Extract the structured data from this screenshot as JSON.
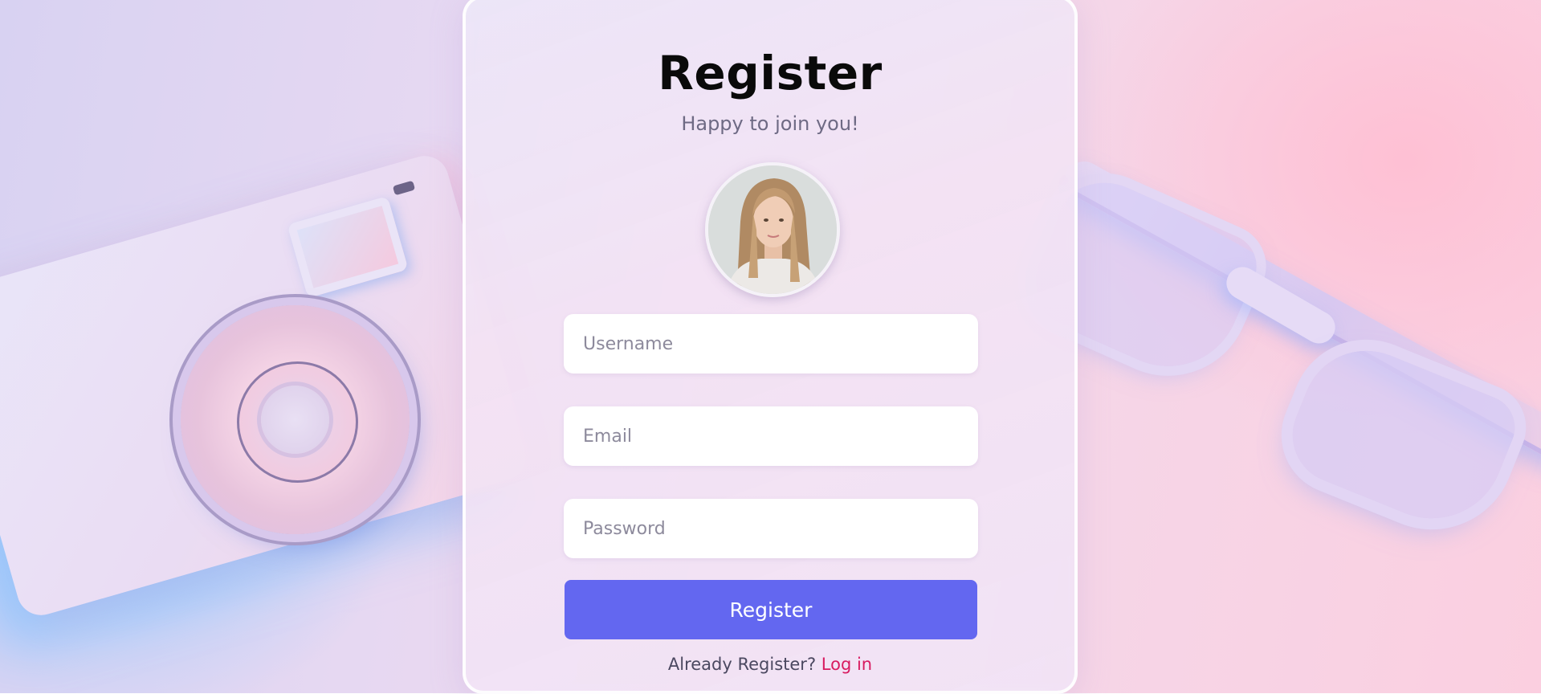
{
  "form": {
    "title": "Register",
    "subtitle": "Happy to join you!",
    "avatar_alt": "profile photo",
    "fields": {
      "username": {
        "placeholder": "Username",
        "value": ""
      },
      "email": {
        "placeholder": "Email",
        "value": ""
      },
      "password": {
        "placeholder": "Password",
        "value": ""
      }
    },
    "submit_label": "Register",
    "footer_text": "Already Register?",
    "login_link": "Log in"
  },
  "colors": {
    "button": "#6367f0",
    "link": "#d81b60",
    "title": "#0a0a0a",
    "subtitle": "#6e6a84"
  },
  "icons": {
    "background_left": "camera-illustration",
    "background_right": "glasses-illustration"
  }
}
